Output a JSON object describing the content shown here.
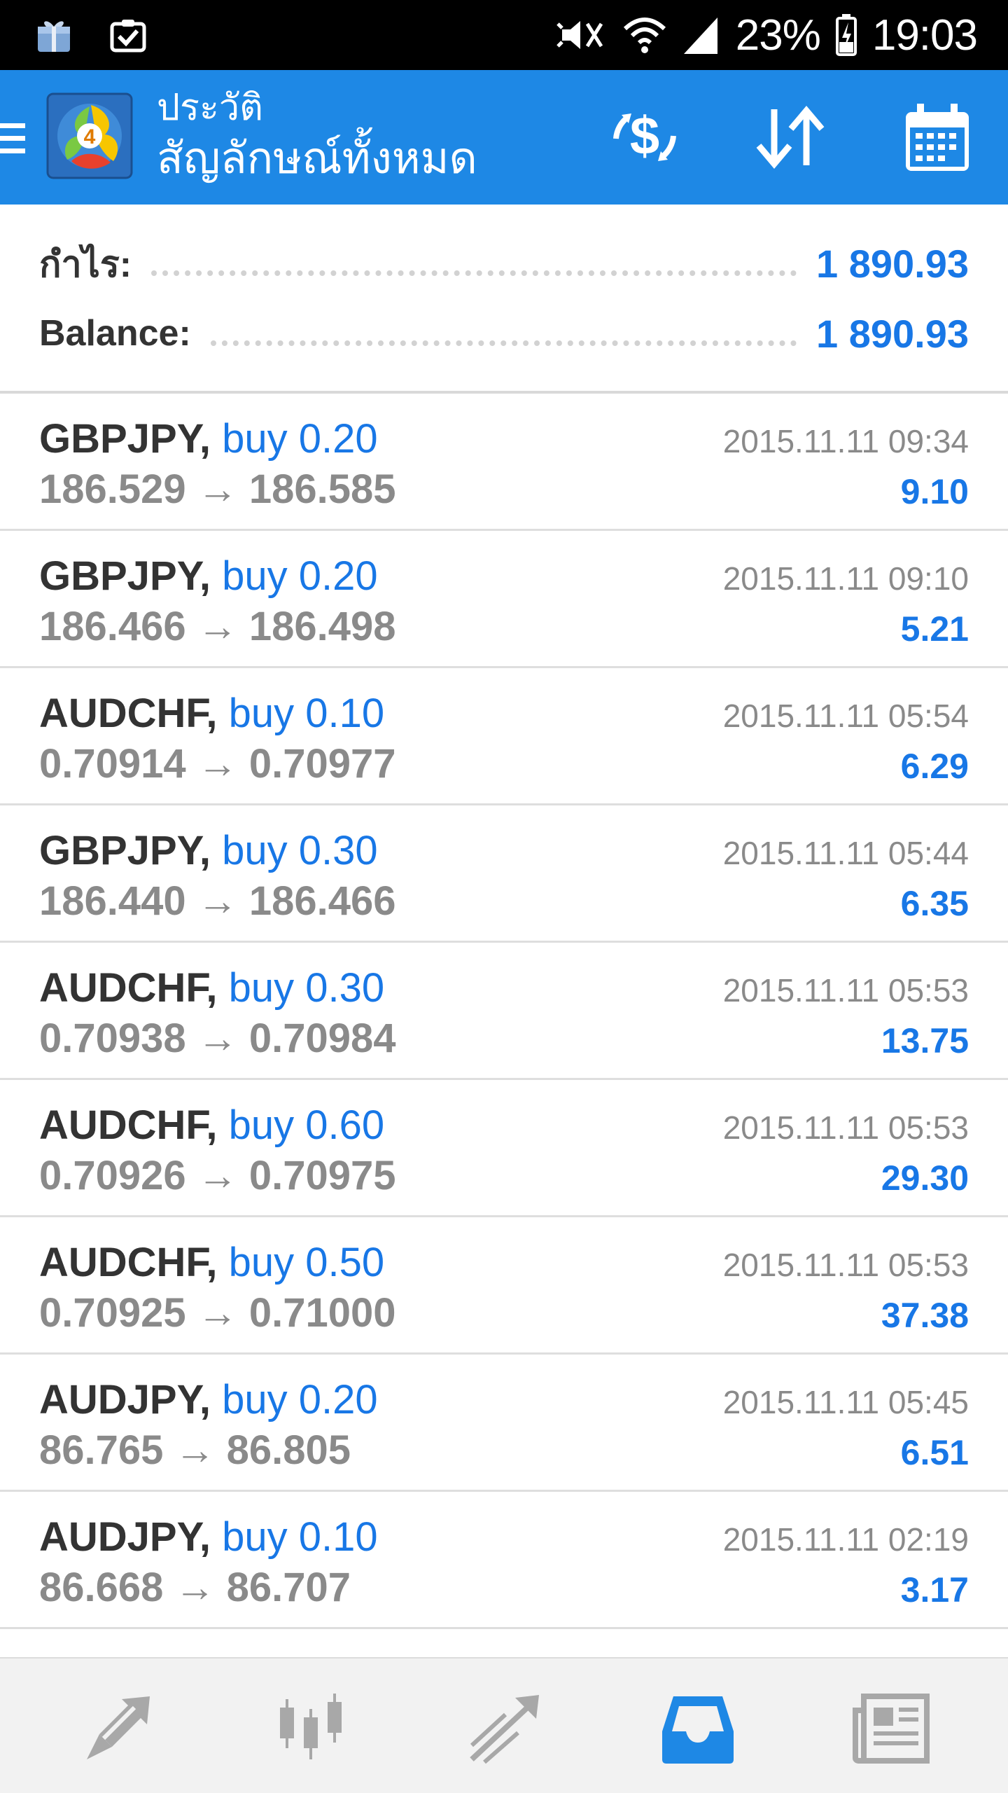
{
  "status_bar": {
    "battery": "23%",
    "time": "19:03",
    "icons": [
      "galaxy-gift-icon",
      "clipboard-check-icon",
      "mute-icon",
      "wifi-icon",
      "signal-icon",
      "battery-icon"
    ]
  },
  "app_bar": {
    "subtitle": "ประวัติ",
    "title": "สัญลักษณ์ทั้งหมด",
    "icons": [
      "menu-icon",
      "metatrader-logo",
      "currency-exchange-icon",
      "sort-icon",
      "calendar-icon"
    ]
  },
  "summary": {
    "profit_label": "กำไร:",
    "profit_value": "1 890.93",
    "balance_label": "Balance:",
    "balance_value": "1 890.93"
  },
  "deals": [
    {
      "symbol": "GBPJPY,",
      "type": "buy 0.20",
      "prices": "186.529 → 186.585",
      "time": "2015.11.11 09:34",
      "profit": "9.10"
    },
    {
      "symbol": "GBPJPY,",
      "type": "buy 0.20",
      "prices": "186.466 → 186.498",
      "time": "2015.11.11 09:10",
      "profit": "5.21"
    },
    {
      "symbol": "AUDCHF,",
      "type": "buy 0.10",
      "prices": "0.70914 → 0.70977",
      "time": "2015.11.11 05:54",
      "profit": "6.29"
    },
    {
      "symbol": "GBPJPY,",
      "type": "buy 0.30",
      "prices": "186.440 → 186.466",
      "time": "2015.11.11 05:44",
      "profit": "6.35"
    },
    {
      "symbol": "AUDCHF,",
      "type": "buy 0.30",
      "prices": "0.70938 → 0.70984",
      "time": "2015.11.11 05:53",
      "profit": "13.75"
    },
    {
      "symbol": "AUDCHF,",
      "type": "buy 0.60",
      "prices": "0.70926 → 0.70975",
      "time": "2015.11.11 05:53",
      "profit": "29.30"
    },
    {
      "symbol": "AUDCHF,",
      "type": "buy 0.50",
      "prices": "0.70925 → 0.71000",
      "time": "2015.11.11 05:53",
      "profit": "37.38"
    },
    {
      "symbol": "AUDJPY,",
      "type": "buy 0.20",
      "prices": "86.765 → 86.805",
      "time": "2015.11.11 05:45",
      "profit": "6.51"
    },
    {
      "symbol": "AUDJPY,",
      "type": "buy 0.10",
      "prices": "86.668 → 86.707",
      "time": "2015.11.11 02:19",
      "profit": "3.17"
    }
  ],
  "bottom_nav": {
    "items": [
      "quotes-icon",
      "chart-icon",
      "trade-icon",
      "history-icon",
      "news-icon"
    ],
    "active": "history-icon",
    "active_color": "#1e88e5",
    "inactive_color": "#a8a8a8"
  },
  "colors": {
    "app_bar": "#1e88e5",
    "accent_text": "#1877e6",
    "dark_text": "#333333",
    "muted_text": "#8a8a8a"
  }
}
